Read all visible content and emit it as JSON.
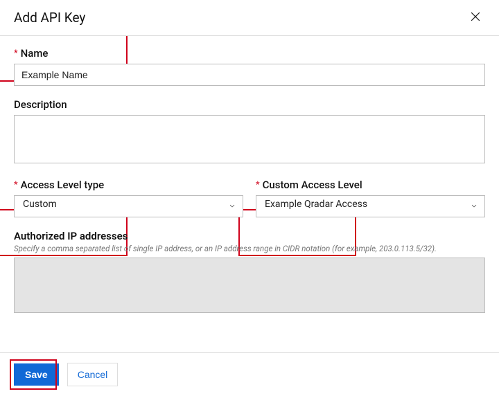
{
  "header": {
    "title": "Add API Key"
  },
  "fields": {
    "name": {
      "label": "Name",
      "value": "Example Name"
    },
    "description": {
      "label": "Description",
      "value": ""
    },
    "accessLevelType": {
      "label": "Access Level type",
      "value": "Custom"
    },
    "customAccessLevel": {
      "label": "Custom Access Level",
      "value": "Example Qradar Access"
    },
    "authorizedIps": {
      "label": "Authorized IP addresses",
      "hint": "Specify a comma separated list of single IP address, or an IP address range in CIDR notation (for example, 203.0.113.5/32).",
      "value": ""
    }
  },
  "footer": {
    "save": "Save",
    "cancel": "Cancel"
  }
}
